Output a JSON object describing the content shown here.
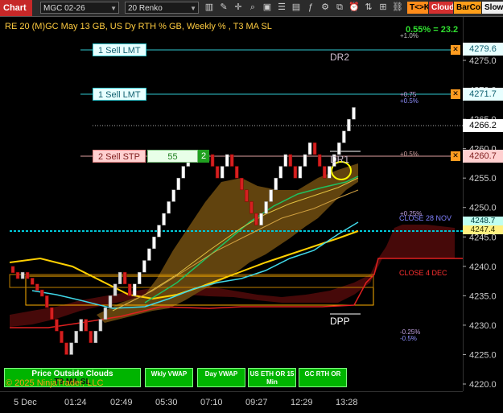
{
  "toolbar": {
    "tab": "Chart",
    "instrument": "MGC 02-26",
    "bar_type": "20 Renko",
    "icons": [
      "chart-style-icon",
      "draw-tool-icon",
      "crosshair-icon",
      "zoom-icon",
      "screenshot-icon",
      "properties-icon",
      "data-box-icon",
      "indicators-icon",
      "strategies-icon",
      "templates-icon",
      "alert-icon",
      "order-entry-icon"
    ],
    "tk_button": "T<>K",
    "cloud_button": "Cloud",
    "barcol_button": "BarCol",
    "slowm_button": "SlowM"
  },
  "header": {
    "description": "RE 20  (M)GC May 13 GB, US Dy RTH % GB, Weekly % , T3 MA SL",
    "change": "0.55% = 23.2"
  },
  "orders": [
    {
      "label": "1 Sell LMT",
      "price": "4279.6"
    },
    {
      "label": "1 Sell LMT",
      "price": "4271.7"
    },
    {
      "label": "2 Sell STP",
      "price": "4260.7",
      "qty": "55",
      "count": "2"
    }
  ],
  "level_labels": {
    "dr2": "DR2",
    "dr1": "DR1",
    "dpp": "DPP",
    "close_nov": "CLOSE 28 NOV",
    "close_dec": "CLOSE 4 DEC",
    "pct_p1_0": "+1.0%",
    "pct_p0_75": "+0.75",
    "pct_p0_5a": "+0.5%",
    "pct_p0_5b": "+0.5%",
    "pct_p0_25": "+0.25%",
    "pct_m0_25": "-0.25%",
    "pct_m0_5": "-0.5%"
  },
  "price_axis": {
    "ticks": [
      "4275.0",
      "4270.0",
      "4265.0",
      "4260.0",
      "4255.0",
      "4250.0",
      "4245.0",
      "4240.0",
      "4235.0",
      "4230.0",
      "4225.0",
      "4220.0"
    ],
    "last_price": "4266.2",
    "tag_green": "4248.7",
    "tag_yellow": "4247.4"
  },
  "time_axis": [
    "5 Dec",
    "01:24",
    "02:49",
    "05:30",
    "07:10",
    "09:27",
    "12:29",
    "13:28"
  ],
  "indicator_buttons": {
    "clouds": "Price Outside Clouds",
    "t3": "T3 MA SL",
    "wkly": "Wkly VWAP",
    "day": "Day VWAP",
    "us_eth": "US ETH OR 15 Min",
    "gc_rth": "GC RTH OR"
  },
  "copyright": "© 2025 NinjaTrader, LLC",
  "chart_data": {
    "type": "candlestick-renko",
    "brick_size": 20,
    "ylim": [
      4218,
      4285
    ],
    "bricks_close": [
      4239,
      4238,
      4239,
      4238,
      4237,
      4236,
      4235,
      4233,
      4231,
      4229,
      4227,
      4225,
      4227,
      4229,
      4231,
      4229,
      4227,
      4229,
      4231,
      4233,
      4235,
      4237,
      4239,
      4237,
      4235,
      4237,
      4239,
      4241,
      4243,
      4245,
      4247,
      4249,
      4251,
      4253,
      4255,
      4257,
      4259,
      4259,
      4259,
      4259,
      4259,
      4257,
      4255,
      4257,
      4259,
      4257,
      4255,
      4253,
      4251,
      4249,
      4247,
      4249,
      4251,
      4253,
      4255,
      4257,
      4259,
      4257,
      4255,
      4257,
      4259,
      4261,
      4259,
      4257,
      4255,
      4257,
      4259,
      4261,
      4263,
      4265,
      4267
    ]
  }
}
